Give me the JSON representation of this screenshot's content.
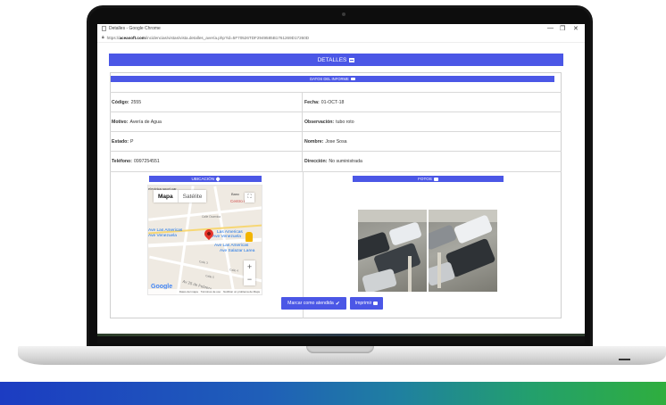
{
  "browser": {
    "window_title": "Detalles - Google Chrome",
    "url_host": "aceasoft.com",
    "url_prefix": "https://",
    "url_path": "/incidencias/vistas/vista.detalles_avería.php?id=5F70526TDF2949585B1761269D17260D",
    "minimize": "—",
    "maximize": "❐",
    "close": "✕"
  },
  "header": {
    "title": "DETALLES",
    "icon": "table-icon"
  },
  "section": {
    "title": "DATOS DEL INFORME",
    "icon": "folder-open-icon"
  },
  "fields": [
    {
      "left_label": "Código:",
      "left_value": "2555",
      "right_label": "Fecha:",
      "right_value": "01-OCT-18"
    },
    {
      "left_label": "Motivo:",
      "left_value": "Avería de Agua",
      "right_label": "Observación:",
      "right_value": "tubo roto"
    },
    {
      "left_label": "Estado:",
      "left_value": "P",
      "right_label": "Nombre:",
      "right_value": "Jose Sosa"
    },
    {
      "left_label": "Teléfono:",
      "left_value": "0997254551",
      "right_label": "Dirección:",
      "right_value": "No suministrada"
    }
  ],
  "location": {
    "title": "UBICACIÓN",
    "icon": "map-marker-icon",
    "map": {
      "tab_map": "Mapa",
      "tab_satellite": "Satélite",
      "labels": [
        "Las Americas",
        "Ave Venezuela",
        "Ave Las Americas",
        "Ave Salazar Larea",
        "Centro m",
        "Ave Las Americas",
        "Ave Venezuela"
      ],
      "top_text": "electrica sport car",
      "right_top": "Banc",
      "streets": [
        "Calle Ocarnica",
        "Calle 3",
        "Calle 4",
        "Calle 5",
        "Av 25 de Febrero"
      ],
      "zoom_in": "+",
      "zoom_out": "−",
      "logo": "Google",
      "footer_items": [
        "Datos del mapa",
        "Términos de uso",
        "Notificar un problema de Maps"
      ]
    }
  },
  "photos": {
    "title": "FOTOS",
    "icon": "camera-icon"
  },
  "actions": {
    "mark_done": "Marcar como atendida",
    "mark_done_icon": "check-icon",
    "print": "Imprimir",
    "print_icon": "print-icon"
  },
  "colors": {
    "accent": "#4b57e6",
    "footer_start": "#1c3cc2",
    "footer_end": "#2fae3e"
  }
}
